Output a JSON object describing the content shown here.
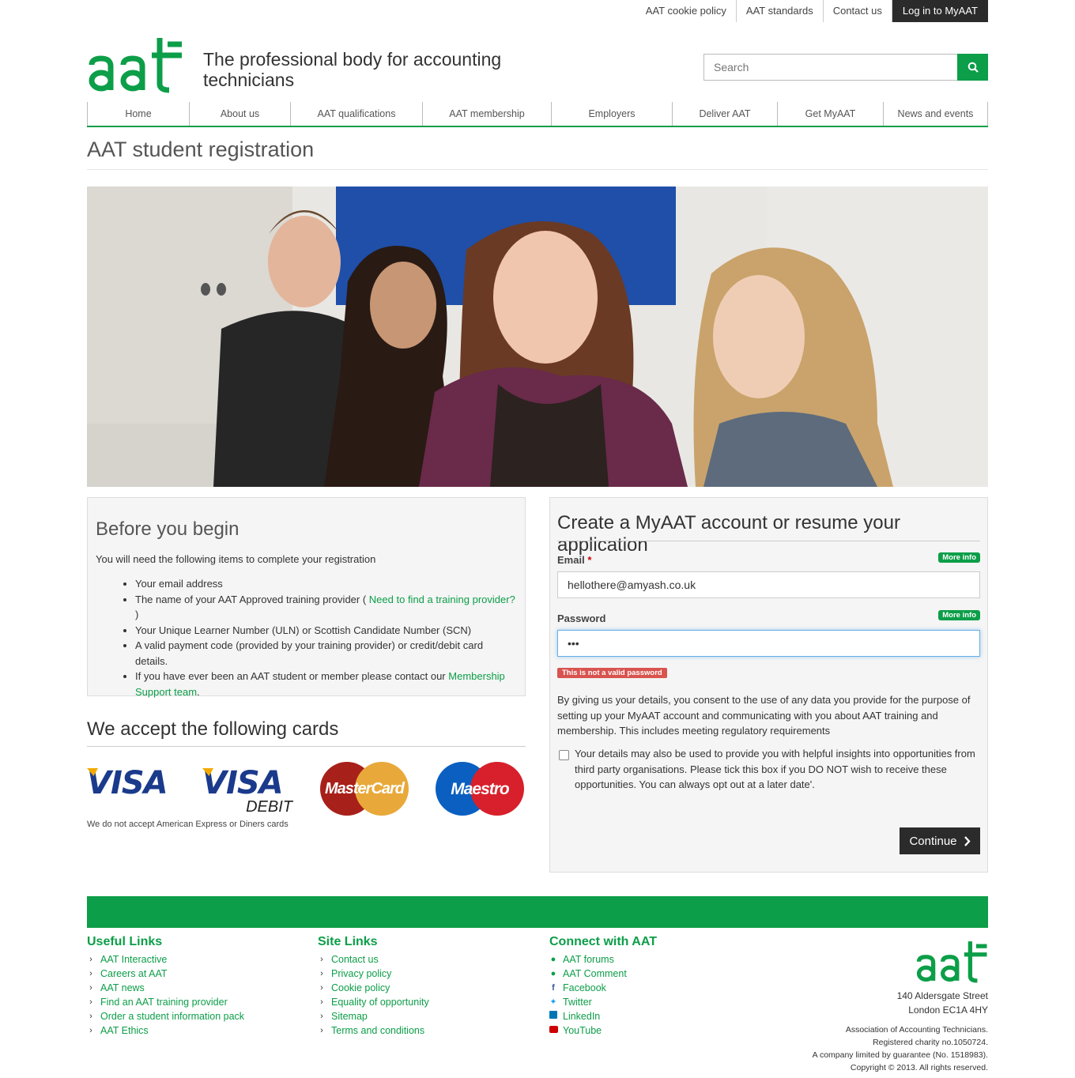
{
  "topbar": {
    "links": [
      "AAT cookie policy",
      "AAT standards",
      "Contact us"
    ],
    "login": "Log in to MyAAT"
  },
  "header": {
    "tagline": "The professional body for accounting technicians",
    "search_placeholder": "Search"
  },
  "nav": [
    "Home",
    "About us",
    "AAT qualifications",
    "AAT membership",
    "Employers",
    "Deliver AAT",
    "Get MyAAT",
    "News and events"
  ],
  "page": {
    "title": "AAT student registration"
  },
  "before": {
    "heading": "Before you begin",
    "intro": "You will need the following items to complete your registration",
    "item1": "Your email address",
    "item2_pre": "The name of your AAT Approved training provider ( ",
    "item2_link": "Need to find a training provider?",
    "item2_post": " )",
    "item3": "Your Unique Learner Number (ULN) or Scottish Candidate Number (SCN)",
    "item4": "A valid payment code (provided by your training provider) or credit/debit card details.",
    "item5_pre": "If you have ever been an AAT student or member please contact our ",
    "item5_link": "Membership Support team",
    "item5_post": "."
  },
  "cards": {
    "heading": "We accept the following cards",
    "visa": "VISA",
    "visa_debit": "VISA",
    "debit": "DEBIT",
    "mastercard": "MasterCard",
    "maestro": "Maestro",
    "note": "We do not accept American Express or Diners cards"
  },
  "form": {
    "heading": "Create a MyAAT account or resume your application",
    "email_label": "Email",
    "required_mark": "*",
    "more_info": "More info",
    "email_value": "hellothere@amyash.co.uk",
    "password_label": "Password",
    "password_value": "•••",
    "error": "This is not a valid password",
    "consent": "By giving us your details, you consent to the use of any data you provide for the purpose of setting up your MyAAT account and communicating with you about AAT training and membership. This includes meeting regulatory requirements",
    "optin": "Your details may also be used to provide you with helpful insights into opportunities from third party organisations. Please tick this box if you DO NOT wish to receive these opportunities. You can always opt out at a later date'.",
    "optin_checked": false,
    "continue": "Continue"
  },
  "footer": {
    "useful_title": "Useful Links",
    "useful": [
      "AAT Interactive",
      "Careers at AAT",
      "AAT news",
      "Find an AAT training provider",
      "Order a student information pack",
      "AAT Ethics"
    ],
    "site_title": "Site Links",
    "site": [
      "Contact us",
      "Privacy policy",
      "Cookie policy",
      "Equality of opportunity",
      "Sitemap",
      "Terms and conditions"
    ],
    "connect_title": "Connect with AAT",
    "connect": [
      {
        "label": "AAT forums",
        "icon": "comments-icon"
      },
      {
        "label": "AAT Comment",
        "icon": "comment-icon"
      },
      {
        "label": "Facebook",
        "icon": "facebook-icon"
      },
      {
        "label": "Twitter",
        "icon": "twitter-icon"
      },
      {
        "label": "LinkedIn",
        "icon": "linkedin-icon"
      },
      {
        "label": "YouTube",
        "icon": "youtube-icon"
      }
    ],
    "address1": "140 Aldersgate Street",
    "address2": "London EC1A 4HY",
    "legal1": "Association of Accounting Technicians.",
    "legal2": "Registered charity no.1050724.",
    "legal3": "A company limited by guarantee (No. 1518983).",
    "legal4": "Copyright © 2013. All rights reserved."
  },
  "colors": {
    "brand_green": "#0c9e48",
    "dark": "#2b2b2b",
    "error_red": "#d9534f"
  }
}
